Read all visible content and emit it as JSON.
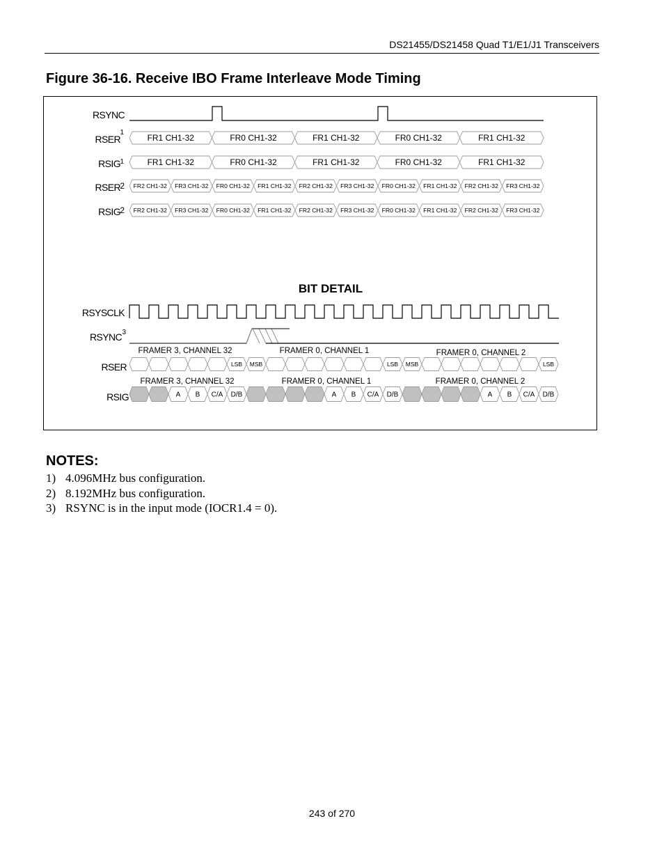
{
  "header": {
    "doc_title": "DS21455/DS21458 Quad T1/E1/J1 Transceivers"
  },
  "figure": {
    "title": "Figure 36-16. Receive IBO Frame Interleave Mode Timing",
    "frame_level": {
      "signals": [
        {
          "id": "rsync",
          "label": "RSYNC",
          "sup": ""
        },
        {
          "id": "rser1",
          "label": "RSER",
          "sup": "1"
        },
        {
          "id": "rsig1",
          "label": "RSIG",
          "sup": "1"
        },
        {
          "id": "rser2",
          "label": "RSER",
          "sup": "2"
        },
        {
          "id": "rsig2",
          "label": "RSIG",
          "sup": "2"
        }
      ],
      "rser1_blocks": [
        "FR1 CH1-32",
        "FR0 CH1-32",
        "FR1 CH1-32",
        "FR0 CH1-32",
        "FR1 CH1-32"
      ],
      "rsig1_blocks": [
        "FR1 CH1-32",
        "FR0 CH1-32",
        "FR1 CH1-32",
        "FR0 CH1-32",
        "FR1 CH1-32"
      ],
      "rser2_blocks": [
        "FR2 CH1-32",
        "FR3 CH1-32",
        "FR0 CH1-32",
        "FR1 CH1-32",
        "FR2 CH1-32",
        "FR3 CH1-32",
        "FR0 CH1-32",
        "FR1 CH1-32",
        "FR2 CH1-32",
        "FR3 CH1-32"
      ],
      "rsig2_blocks": [
        "FR2 CH1-32",
        "FR3 CH1-32",
        "FR0 CH1-32",
        "FR1 CH1-32",
        "FR2 CH1-32",
        "FR3 CH1-32",
        "FR0 CH1-32",
        "FR1 CH1-32",
        "FR2 CH1-32",
        "FR3 CH1-32"
      ]
    },
    "bit_detail": {
      "title": "BIT DETAIL",
      "signals": [
        {
          "id": "rsysclk",
          "label": "RSYSCLK",
          "sup": ""
        },
        {
          "id": "rsync3",
          "label": "RSYNC",
          "sup": "3"
        },
        {
          "id": "rser",
          "label": "RSER",
          "sup": ""
        },
        {
          "id": "rsig",
          "label": "RSIG",
          "sup": ""
        }
      ],
      "rser_group_labels": [
        "FRAMER 3, CHANNEL 32",
        "FRAMER 0, CHANNEL 1",
        "FRAMER 0, CHANNEL 2"
      ],
      "rsig_group_labels": [
        "FRAMER 3, CHANNEL 32",
        "FRAMER 0, CHANNEL 1",
        "FRAMER 0, CHANNEL 2"
      ],
      "rser_cells": [
        "",
        "",
        "",
        "",
        "",
        "LSB",
        "MSB",
        "",
        "",
        "",
        "",
        "",
        "",
        "LSB",
        "MSB",
        "",
        "",
        "",
        "",
        "",
        "",
        "LSB"
      ],
      "rsig_cells": [
        "#",
        "#",
        "A",
        "B",
        "C/A",
        "D/B",
        "#",
        "#",
        "#",
        "#",
        "A",
        "B",
        "C/A",
        "D/B",
        "#",
        "#",
        "#",
        "#",
        "A",
        "B",
        "C/A",
        "D/B"
      ],
      "shaded_color": "#c0c0c0"
    }
  },
  "notes": {
    "title": "NOTES:",
    "items": [
      {
        "num": "1)",
        "text": "4.096MHz bus configuration."
      },
      {
        "num": "2)",
        "text": "8.192MHz bus configuration."
      },
      {
        "num": "3)",
        "text": "RSYNC is in the input mode (IOCR1.4 = 0)."
      }
    ]
  },
  "footer": {
    "page": "243 of 270"
  }
}
